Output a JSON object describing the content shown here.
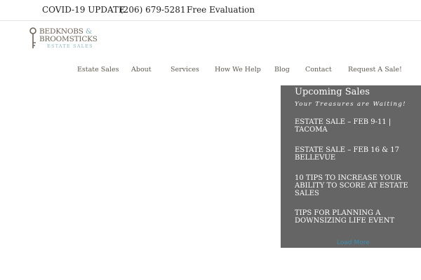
{
  "topbar": {
    "covid": "COVID-19 UPDATE",
    "phone": "(206) 679-5281",
    "evaluation": "Free Evaluation"
  },
  "logo": {
    "line1": "BEDKNOBS",
    "amp": "&",
    "line2": "BROOMSTICKS",
    "subtitle": "ESTATE SALES",
    "icon": "skeleton-key-icon",
    "text_color": "#6d6458",
    "accent_color": "#8fb7c4"
  },
  "nav": {
    "items": [
      {
        "label": "Estate Sales"
      },
      {
        "label": "About"
      },
      {
        "label": "Services"
      },
      {
        "label": "How We Help"
      },
      {
        "label": "Blog"
      },
      {
        "label": "Contact"
      },
      {
        "label": "Request A Sale!"
      }
    ]
  },
  "upcoming": {
    "title": "Upcoming Sales",
    "tagline": "Your Treasures are Waiting!",
    "posts": [
      {
        "title": "ESTATE SALE – FEB 9-11 | TACOMA"
      },
      {
        "title": "ESTATE SALE – FEB 16 & 17 BELLEVUE"
      },
      {
        "title": "10 TIPS TO INCREASE YOUR ABILITY TO SCORE AT ESTATE SALES"
      },
      {
        "title": "TIPS FOR PLANNING A DOWNSIZING LIFE EVENT"
      }
    ],
    "load_more": "Load More",
    "background": "#656565",
    "link_color": "#3c8fb3"
  }
}
